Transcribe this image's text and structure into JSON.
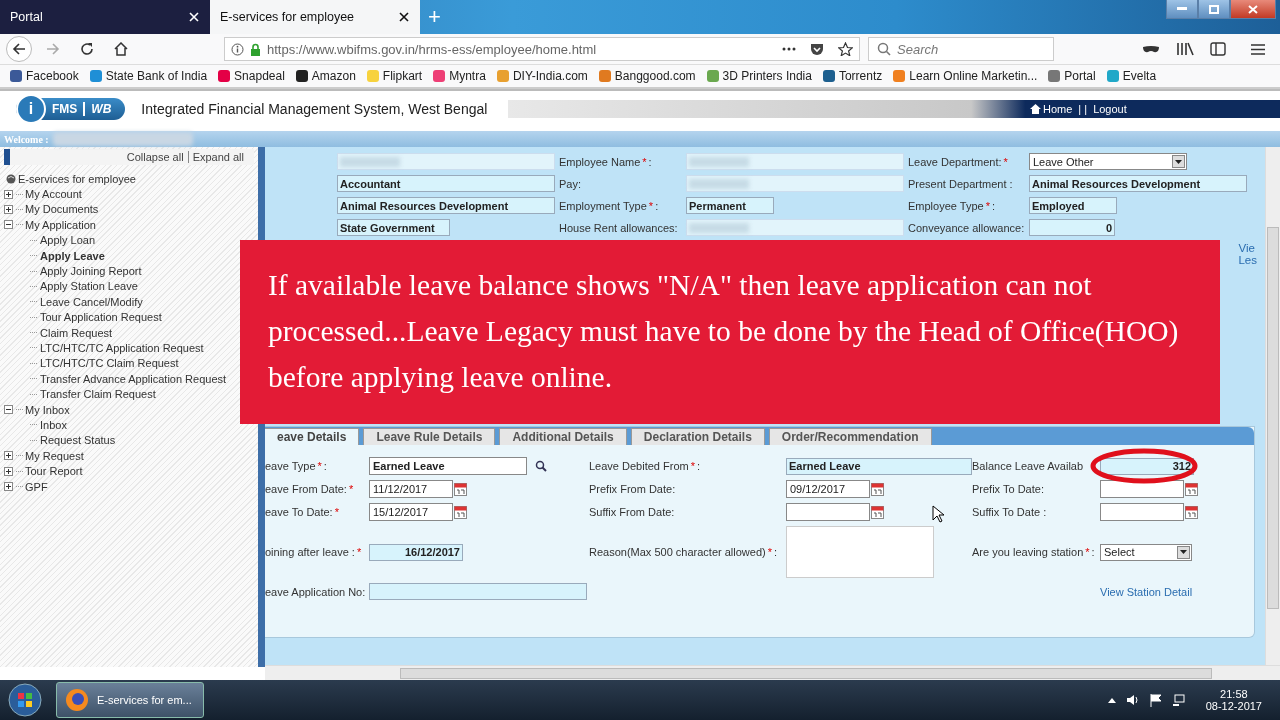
{
  "browser": {
    "tabs": [
      {
        "title": "Portal",
        "selected": false
      },
      {
        "title": "E-services for employee",
        "selected": true
      }
    ],
    "new_tab": "+",
    "url": "https://www.wbifms.gov.in/hrms-ess/employee/home.html",
    "search": {
      "placeholder": "Search"
    },
    "bookmarks": [
      {
        "label": "Facebook",
        "color": "#3b5998"
      },
      {
        "label": "State Bank of India",
        "color": "#1f8fd6"
      },
      {
        "label": "Snapdeal",
        "color": "#e40046"
      },
      {
        "label": "Amazon",
        "color": "#222222"
      },
      {
        "label": "Flipkart",
        "color": "#f7d23e"
      },
      {
        "label": "Myntra",
        "color": "#ee3f76"
      },
      {
        "label": "DIY-India.com",
        "color": "#e8a030"
      },
      {
        "label": "Banggood.com",
        "color": "#e07a20"
      },
      {
        "label": "3D Printers India",
        "color": "#6aa84f"
      },
      {
        "label": "Torrentz",
        "color": "#1d5f8f"
      },
      {
        "label": "Learn Online Marketin...",
        "color": "#f08020"
      },
      {
        "label": "Portal",
        "color": "#777777"
      },
      {
        "label": "Evelta",
        "color": "#20a8c8"
      }
    ]
  },
  "site": {
    "logo": [
      "i",
      "FMS",
      "WB"
    ],
    "title": "Integrated Financial Management System, West Bengal",
    "links": [
      {
        "label": "Home"
      },
      {
        "label": "Logout"
      }
    ],
    "separator": "| |",
    "welcome": "Welcome :"
  },
  "sidebar": {
    "collapse": "Collapse all",
    "expand": "Expand all",
    "root": {
      "label": "E-services for employee",
      "children": [
        {
          "label": "My Account",
          "expanded": false,
          "selected": false
        },
        {
          "label": "My Documents",
          "expanded": false,
          "selected": false
        },
        {
          "label": "My Application",
          "expanded": true,
          "selected": false,
          "children": [
            {
              "label": "Apply Loan",
              "selected": false
            },
            {
              "label": "Apply Leave",
              "selected": true
            },
            {
              "label": "Apply Joining Report",
              "selected": false
            },
            {
              "label": "Apply Station Leave",
              "selected": false
            },
            {
              "label": "Leave Cancel/Modify",
              "selected": false
            },
            {
              "label": "Tour Application Request",
              "selected": false
            },
            {
              "label": "Claim Request",
              "selected": false
            },
            {
              "label": "LTC/HTC/TC Application Request",
              "selected": false
            },
            {
              "label": "LTC/HTC/TC Claim Request",
              "selected": false
            },
            {
              "label": "Transfer Advance Application Request",
              "selected": false
            },
            {
              "label": "Transfer Claim Request",
              "selected": false
            }
          ]
        },
        {
          "label": "My Inbox",
          "expanded": true,
          "selected": false,
          "children": [
            {
              "label": "Inbox",
              "selected": false
            },
            {
              "label": "Request Status",
              "selected": false
            }
          ]
        },
        {
          "label": "My Request",
          "expanded": false,
          "selected": false
        },
        {
          "label": "Tour Report",
          "expanded": false,
          "selected": false
        },
        {
          "label": "GPF",
          "expanded": false,
          "selected": false
        }
      ]
    }
  },
  "employee": {
    "rows": [
      [
        {
          "field": {
            "kind": "redacted"
          }
        },
        {
          "label": "Employee Name",
          "req": "*",
          "tail": ":",
          "field": {
            "kind": "redacted"
          }
        },
        {
          "label": "Leave Department:",
          "req": "*",
          "field": {
            "kind": "select",
            "value": "Leave Other"
          }
        }
      ],
      [
        {
          "field": {
            "kind": "readonly",
            "value": "Accountant"
          }
        },
        {
          "label": "Pay:",
          "field": {
            "kind": "redacted"
          }
        },
        {
          "label": "Present Department :",
          "field": {
            "kind": "readonly",
            "value": "Animal Resources Development"
          }
        }
      ],
      [
        {
          "field": {
            "kind": "readonly",
            "value": "Animal Resources Development"
          }
        },
        {
          "label": "Employment Type",
          "req": "*",
          "tail": ":",
          "field": {
            "kind": "short",
            "value": "Permanent"
          }
        },
        {
          "label": "Employee Type",
          "req": "*",
          "tail": ":",
          "field": {
            "kind": "short",
            "value": "Employed"
          }
        }
      ],
      [
        {
          "field": {
            "kind": "short",
            "value": "State Government"
          }
        },
        {
          "label": "House Rent allowances:",
          "field": {
            "kind": "redacted"
          }
        },
        {
          "label": "Conveyance allowance:",
          "field": {
            "kind": "figure",
            "value": "0"
          }
        }
      ]
    ],
    "side_links": [
      "Vie",
      "Les"
    ]
  },
  "notice": "If available leave balance shows \"N/A\" then leave application can not processed...Leave Legacy must have to be done by the Head of Office(HOO) before applying leave online.",
  "leave": {
    "tabs": [
      {
        "label": "eave Details",
        "selected": true
      },
      {
        "label": "Leave Rule Details",
        "selected": false
      },
      {
        "label": "Additional Details",
        "selected": false
      },
      {
        "label": "Declaration Details",
        "selected": false
      },
      {
        "label": "Order/Recommendation",
        "selected": false
      }
    ],
    "rows": [
      [
        {
          "label": "eave Type",
          "req": "*",
          "tail": ":",
          "field": {
            "kind": "lookup",
            "value": "Earned Leave"
          }
        },
        {
          "label": "Leave Debited From",
          "req": "*",
          "tail": ":",
          "field": {
            "kind": "readonly",
            "value": "Earned Leave"
          }
        },
        {
          "label": "Balance Leave Availab",
          "field": {
            "kind": "figure",
            "value": "312",
            "circled": true
          }
        }
      ],
      [
        {
          "label": "eave From Date:",
          "req": "*",
          "field": {
            "kind": "date",
            "value": "11/12/2017"
          }
        },
        {
          "label": "Prefix From Date:",
          "field": {
            "kind": "date",
            "value": "09/12/2017"
          }
        },
        {
          "label": "Prefix To Date:",
          "field": {
            "kind": "date"
          }
        }
      ],
      [
        {
          "label": "eave To Date:",
          "req": "*",
          "field": {
            "kind": "date",
            "value": "15/12/2017"
          }
        },
        {
          "label": "Suffix From Date:",
          "field": {
            "kind": "date"
          }
        },
        {
          "label": "Suffix To Date :",
          "field": {
            "kind": "date"
          }
        }
      ],
      [
        {
          "label": "oining after leave :",
          "req": "*",
          "field": {
            "kind": "figure",
            "value": "16/12/2017"
          }
        },
        {
          "label": "Reason(Max 500 character allowed)",
          "req": "*",
          "tail": ":",
          "field": {
            "kind": "textarea"
          }
        },
        {
          "label": "Are you leaving station",
          "req": "*",
          "tail": ":",
          "field": {
            "kind": "select",
            "value": "Select"
          }
        }
      ],
      [
        {
          "label": "eave Application No:",
          "field": {
            "kind": "readonly"
          }
        },
        {},
        {
          "field": {
            "kind": "link",
            "value": "View Station Detail"
          }
        }
      ]
    ]
  },
  "taskbar": {
    "app": "E-services for em...",
    "time": "21:58",
    "date": "08-12-2017"
  }
}
